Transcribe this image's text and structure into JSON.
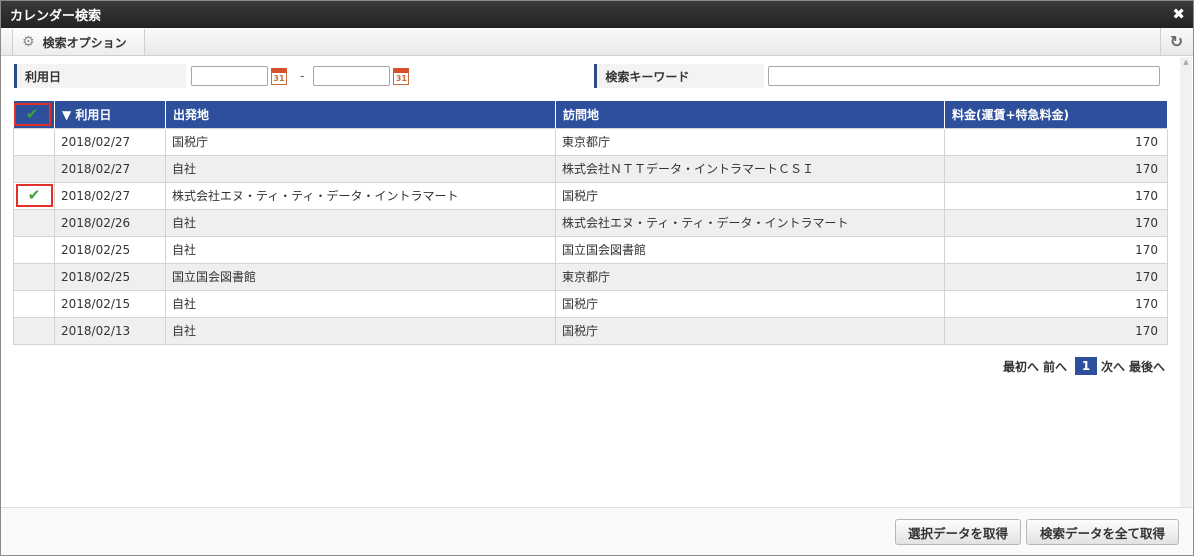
{
  "window": {
    "title": "カレンダー検索"
  },
  "toolbar": {
    "options_label": "検索オプション"
  },
  "search": {
    "date_label": "利用日",
    "date_from": "",
    "date_to": "",
    "date_separator": "-",
    "calendar_icon_text": "31",
    "keyword_label": "検索キーワード",
    "keyword_value": ""
  },
  "table": {
    "columns": [
      "▼ 利用日",
      "出発地",
      "訪問地",
      "料金(運賃+特急料金)"
    ],
    "rows": [
      {
        "checked": false,
        "date": "2018/02/27",
        "from": "国税庁",
        "to": "東京都庁",
        "fare": "170"
      },
      {
        "checked": false,
        "date": "2018/02/27",
        "from": "自社",
        "to": "株式会社ＮＴＴデータ・イントラマートＣＳＩ",
        "fare": "170"
      },
      {
        "checked": true,
        "date": "2018/02/27",
        "from": "株式会社エヌ・ティ・ティ・データ・イントラマート",
        "to": "国税庁",
        "fare": "170"
      },
      {
        "checked": false,
        "date": "2018/02/26",
        "from": "自社",
        "to": "株式会社エヌ・ティ・ティ・データ・イントラマート",
        "fare": "170"
      },
      {
        "checked": false,
        "date": "2018/02/25",
        "from": "自社",
        "to": "国立国会図書館",
        "fare": "170"
      },
      {
        "checked": false,
        "date": "2018/02/25",
        "from": "国立国会図書館",
        "to": "東京都庁",
        "fare": "170"
      },
      {
        "checked": false,
        "date": "2018/02/15",
        "from": "自社",
        "to": "国税庁",
        "fare": "170"
      },
      {
        "checked": false,
        "date": "2018/02/13",
        "from": "自社",
        "to": "国税庁",
        "fare": "170"
      }
    ]
  },
  "pager": {
    "first": "最初へ",
    "prev": "前へ",
    "current": "1",
    "next": "次へ",
    "last": "最後へ"
  },
  "footer": {
    "get_selected": "選択データを取得",
    "get_all": "検索データを全て取得"
  },
  "colors": {
    "header_bg": "#2e4f9c",
    "highlight_border": "#e0302a",
    "check": "#3aa43a"
  }
}
